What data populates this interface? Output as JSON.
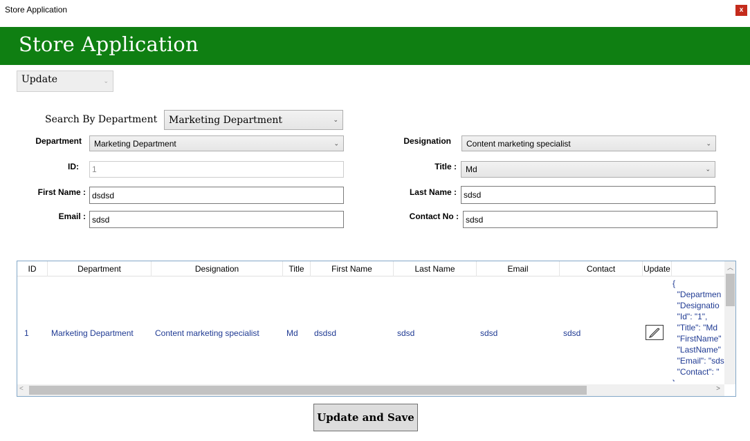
{
  "window": {
    "title": "Store Application",
    "close_label": "x"
  },
  "banner": {
    "heading": "Store Application"
  },
  "mode_select": {
    "value": "Update"
  },
  "search": {
    "label": "Search By Department",
    "value": "Marketing Department"
  },
  "form": {
    "department": {
      "label": "Department",
      "value": "Marketing Department"
    },
    "designation": {
      "label": "Designation",
      "value": "Content marketing specialist"
    },
    "id": {
      "label": "ID:",
      "value": "1"
    },
    "title": {
      "label": "Title :",
      "value": "Md"
    },
    "first_name": {
      "label": "First Name :",
      "value": "dsdsd"
    },
    "last_name": {
      "label": "Last Name :",
      "value": "sdsd"
    },
    "email": {
      "label": "Email :",
      "value": "sdsd"
    },
    "contact": {
      "label": "Contact No :",
      "value": "sdsd"
    }
  },
  "grid": {
    "columns": [
      "ID",
      "Department",
      "Designation",
      "Title",
      "First Name",
      "Last Name",
      "Email",
      "Contact",
      "Update"
    ],
    "rows": [
      {
        "id": "1",
        "department": "Marketing Department",
        "designation": "Content marketing specialist",
        "title": "Md",
        "first_name": "dsdsd",
        "last_name": "sdsd",
        "email": "sdsd",
        "contact": "sdsd",
        "json": "{\n  \"Departmen\n  \"Designatio\n  \"Id\": \"1\",\n  \"Title\": \"Md\n  \"FirstName\"\n  \"LastName\"\n  \"Email\": \"sds\n  \"Contact\": \"\n}"
      }
    ]
  },
  "actions": {
    "save_label": "Update and Save"
  }
}
